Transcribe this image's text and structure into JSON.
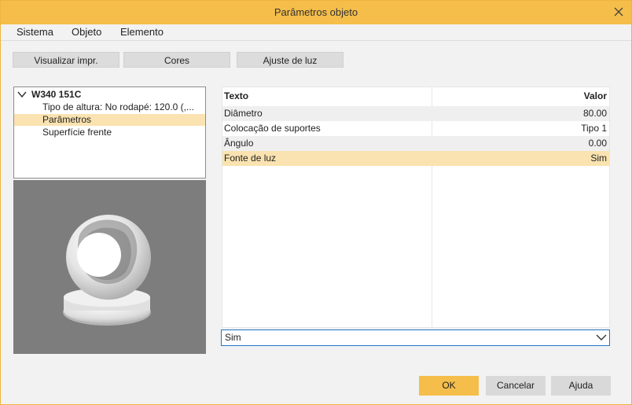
{
  "window": {
    "title": "Parâmetros objeto"
  },
  "menu": {
    "items": [
      "Sistema",
      "Objeto",
      "Elemento"
    ]
  },
  "toolbar": {
    "buttons": [
      "Visualizar impr.",
      "Cores",
      "Ajuste de luz"
    ]
  },
  "tree": {
    "root": "W340 151C",
    "children": [
      "Tipo de altura: No rodapé:  120.0 (,...",
      "Parâmetros",
      "Superfície frente"
    ],
    "selected_index": 1
  },
  "grid": {
    "headers": {
      "text": "Texto",
      "value": "Valor"
    },
    "rows": [
      {
        "text": "Diâmetro",
        "value": "80.00"
      },
      {
        "text": "Colocação de suportes",
        "value": "Tipo 1"
      },
      {
        "text": "Ângulo",
        "value": "0.00"
      },
      {
        "text": "Fonte de luz",
        "value": "Sim"
      }
    ],
    "selected_row": 3
  },
  "dropdown": {
    "value": "Sim"
  },
  "buttons": {
    "ok": "OK",
    "cancel": "Cancelar",
    "help": "Ajuda"
  },
  "colors": {
    "accent": "#f5be4a",
    "selection": "#fae3b0",
    "preview_bg": "#7d7d7d"
  },
  "icons": [
    "close-icon",
    "chevron-down-icon",
    "tree-expand-icon"
  ]
}
